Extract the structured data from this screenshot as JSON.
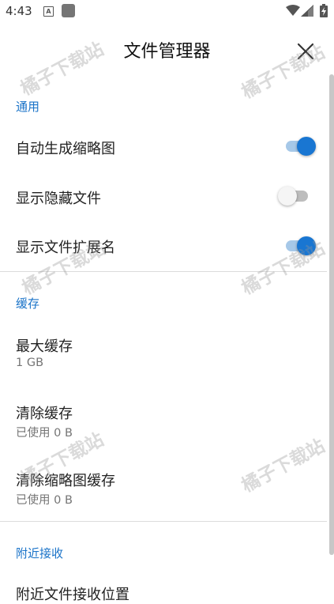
{
  "status_bar": {
    "time": "4:43",
    "a_icon_letter": "A",
    "icons": [
      "notification-a-icon",
      "notification-square-icon",
      "wifi-icon",
      "signal-icon",
      "battery-icon"
    ]
  },
  "header": {
    "title": "文件管理器",
    "close_icon": "close-icon"
  },
  "sections": {
    "general": {
      "header": "通用",
      "auto_thumbnail": {
        "label": "自动生成缩略图",
        "enabled": true
      },
      "show_hidden": {
        "label": "显示隐藏文件",
        "enabled": false
      },
      "show_extensions": {
        "label": "显示文件扩展名",
        "enabled": true
      }
    },
    "cache": {
      "header": "缓存",
      "max_cache": {
        "label": "最大缓存",
        "value": "1 GB"
      },
      "clear_cache": {
        "label": "清除缓存",
        "value": "已使用 0 B"
      },
      "clear_thumbnail_cache": {
        "label": "清除缩略图缓存",
        "value": "已使用 0 B"
      }
    },
    "nearby": {
      "header": "附近接收",
      "receive_location": {
        "label": "附近文件接收位置"
      }
    }
  },
  "watermark_text": "橘子下载站",
  "colors": {
    "accent": "#1a73c8",
    "switch_on_thumb": "#1976d2",
    "switch_on_track": "#a6c8e8",
    "switch_off_track": "#bdbdbd",
    "secondary_text": "#757575"
  }
}
